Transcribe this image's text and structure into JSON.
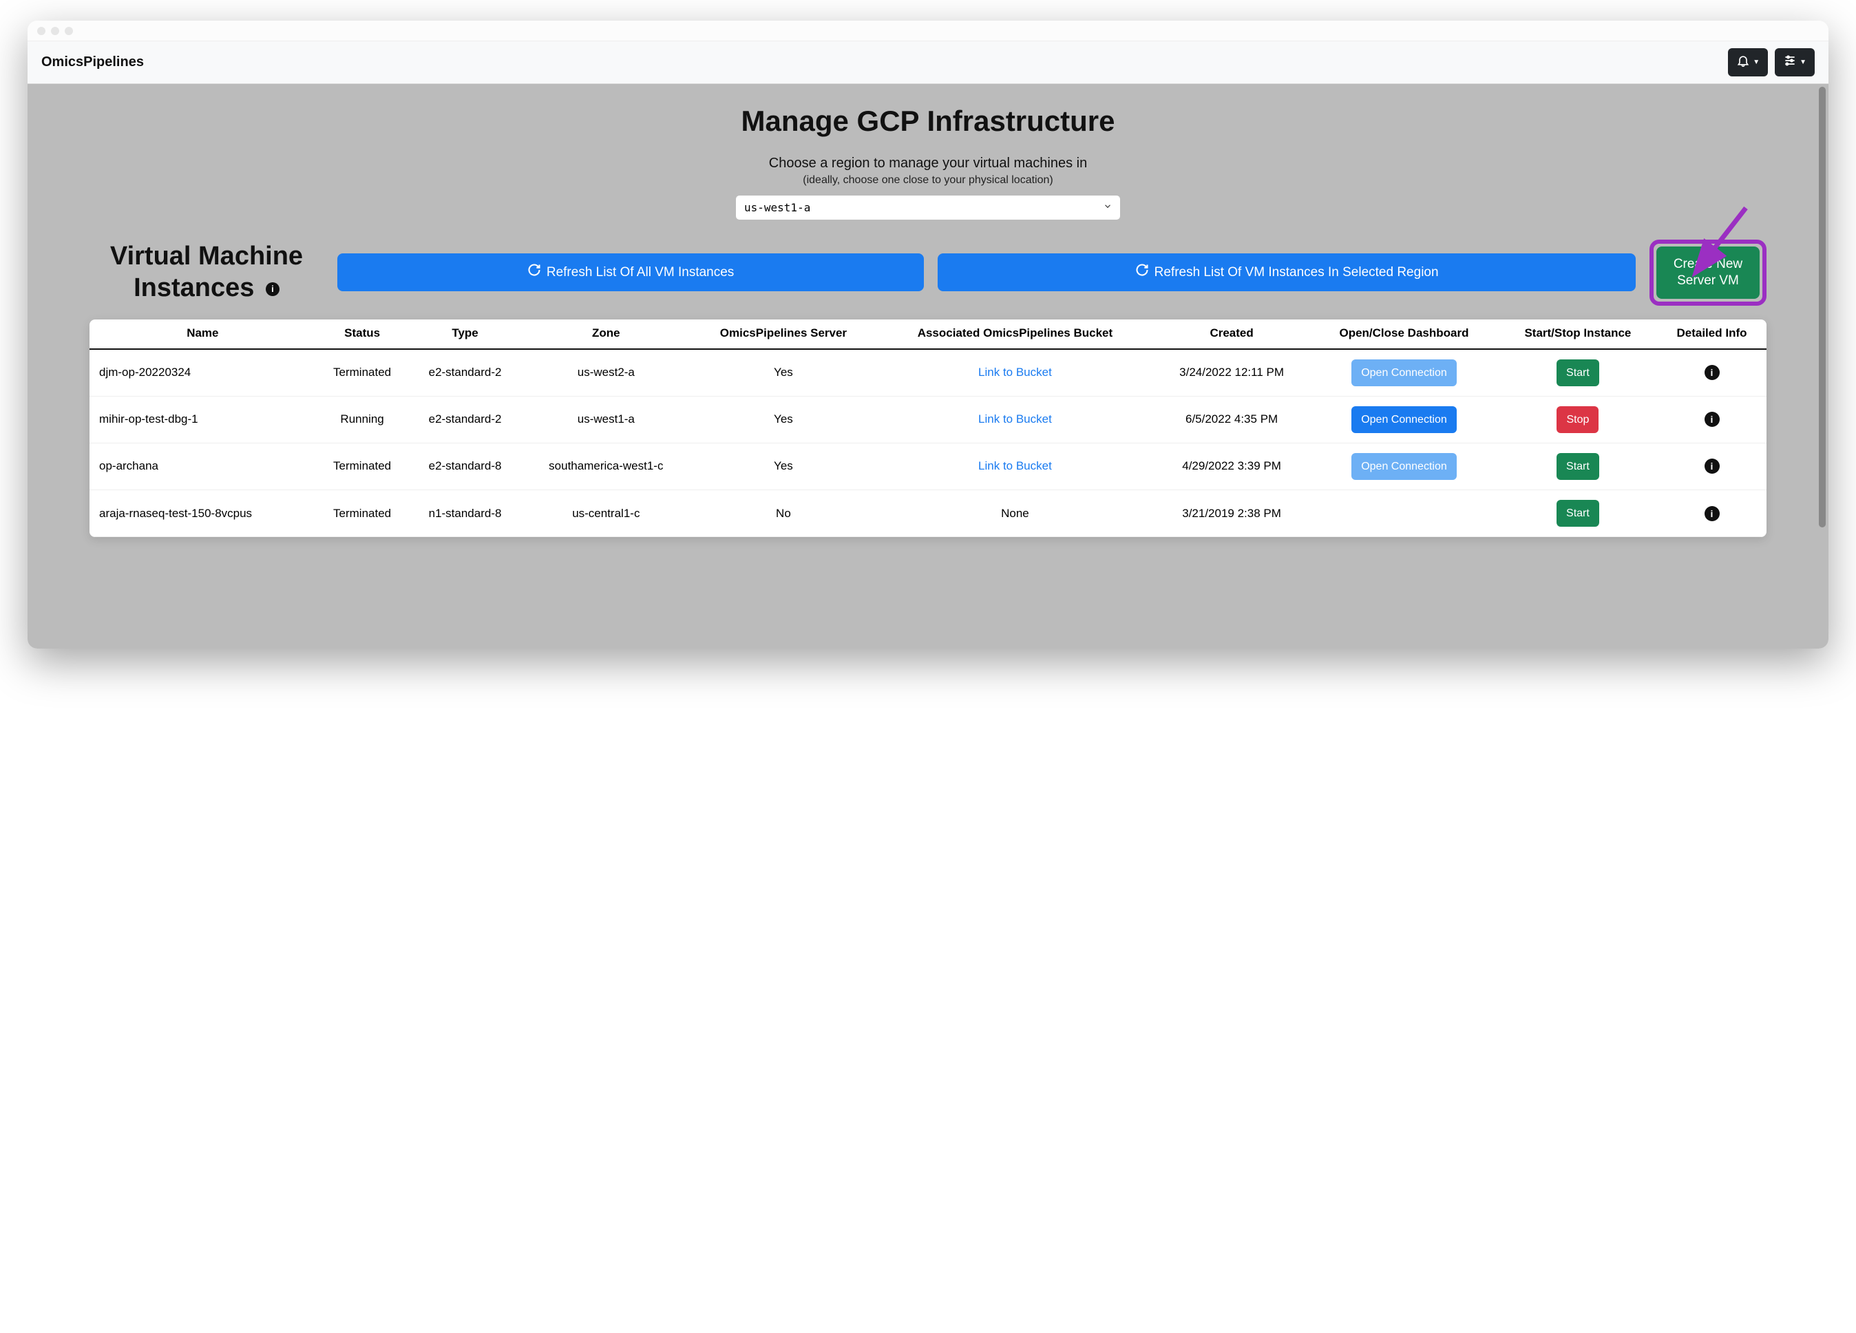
{
  "brand": "OmicsPipelines",
  "page": {
    "title": "Manage GCP Infrastructure",
    "subtitle": "Choose a region to manage your virtual machines in",
    "subtitle_note": "(ideally, choose one close to your physical location)"
  },
  "region_select": {
    "value": "us-west1-a"
  },
  "section_heading": "Virtual Machine Instances",
  "buttons": {
    "refresh_all": "Refresh List Of All VM Instances",
    "refresh_region": "Refresh List Of VM Instances In Selected Region",
    "create_vm": "Create New Server VM"
  },
  "table": {
    "headers": {
      "name": "Name",
      "status": "Status",
      "type": "Type",
      "zone": "Zone",
      "server": "OmicsPipelines Server",
      "bucket": "Associated OmicsPipelines Bucket",
      "created": "Created",
      "dashboard": "Open/Close Dashboard",
      "startstop": "Start/Stop Instance",
      "detail": "Detailed Info"
    },
    "rows": [
      {
        "name": "djm-op-20220324",
        "status": "Terminated",
        "type": "e2-standard-2",
        "zone": "us-west2-a",
        "server": "Yes",
        "bucket": "Link to Bucket",
        "bucket_is_link": true,
        "created": "3/24/2022 12:11 PM",
        "dashboard_label": "Open Connection",
        "dashboard_enabled": false,
        "startstop_label": "Start",
        "startstop_color": "green"
      },
      {
        "name": "mihir-op-test-dbg-1",
        "status": "Running",
        "type": "e2-standard-2",
        "zone": "us-west1-a",
        "server": "Yes",
        "bucket": "Link to Bucket",
        "bucket_is_link": true,
        "created": "6/5/2022 4:35 PM",
        "dashboard_label": "Open Connection",
        "dashboard_enabled": true,
        "startstop_label": "Stop",
        "startstop_color": "red"
      },
      {
        "name": "op-archana",
        "status": "Terminated",
        "type": "e2-standard-8",
        "zone": "southamerica-west1-c",
        "server": "Yes",
        "bucket": "Link to Bucket",
        "bucket_is_link": true,
        "created": "4/29/2022 3:39 PM",
        "dashboard_label": "Open Connection",
        "dashboard_enabled": false,
        "startstop_label": "Start",
        "startstop_color": "green"
      },
      {
        "name": "araja-rnaseq-test-150-8vcpus",
        "status": "Terminated",
        "type": "n1-standard-8",
        "zone": "us-central1-c",
        "server": "No",
        "bucket": "None",
        "bucket_is_link": false,
        "created": "3/21/2019 2:38 PM",
        "dashboard_label": "",
        "dashboard_enabled": null,
        "startstop_label": "Start",
        "startstop_color": "green"
      }
    ]
  },
  "annotation": {
    "highlight": "create-vm-button",
    "arrow": true
  }
}
